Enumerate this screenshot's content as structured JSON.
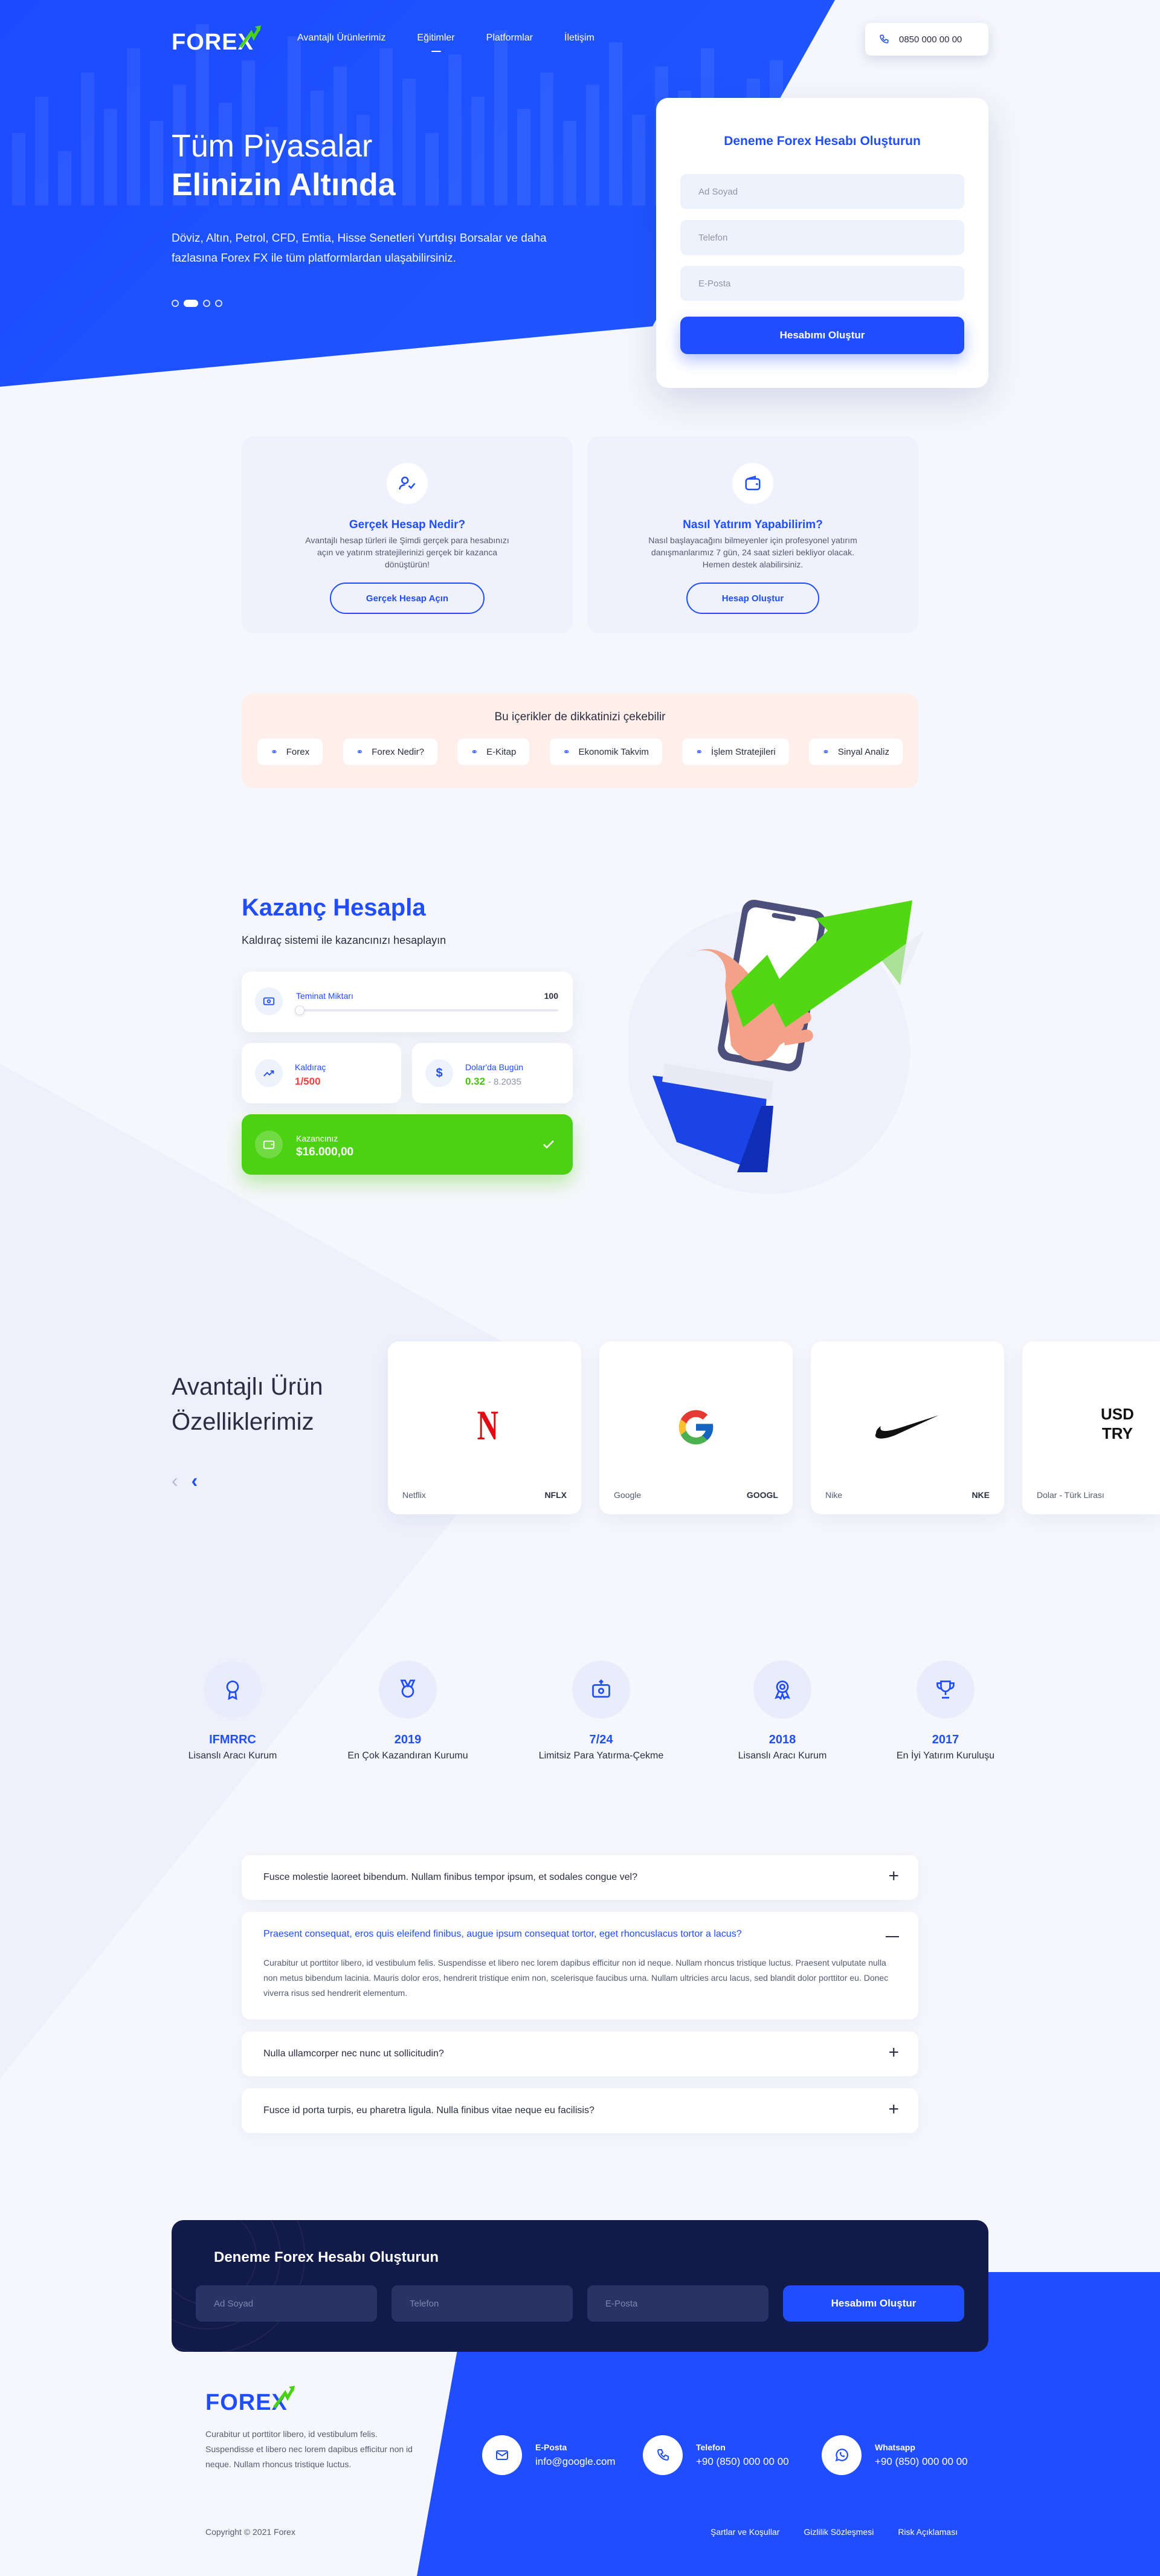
{
  "brand": {
    "logo_text": "FOREX",
    "logo_accent": "#47d40f",
    "primary": "#1f4dff",
    "dark": "#121a4a"
  },
  "nav": {
    "items": [
      {
        "label": "Avantajlı Ürünlerimiz"
      },
      {
        "label": "Eğitimler"
      },
      {
        "label": "Platformlar"
      },
      {
        "label": "İletişim"
      }
    ],
    "phone": "0850 000 00 00"
  },
  "hero": {
    "title_light": "Tüm Piyasalar",
    "title_bold": "Elinizin Altında",
    "description": "Döviz, Altın, Petrol, CFD, Emtia, Hisse Senetleri Yurtdışı Borsalar ve daha fazlasına Forex FX ile tüm platformlardan ulaşabilirsiniz.",
    "slider": {
      "current": 2,
      "total": 4
    }
  },
  "signup": {
    "title": "Deneme Forex Hesabı Oluşturun",
    "name_placeholder": "Ad Soyad",
    "phone_placeholder": "Telefon",
    "email_placeholder": "E-Posta",
    "button": "Hesabımı Oluştur"
  },
  "info_cards": [
    {
      "title": "Gerçek Hesap Nedir?",
      "text": "Avantajlı hesap türleri ile Şimdi gerçek para hesabınızı açın ve yatırım stratejilerinizi gerçek bir kazanca dönüştürün!",
      "button": "Gerçek Hesap Açın",
      "icon": "user-check-icon"
    },
    {
      "title": "Nasıl Yatırım Yapabilirim?",
      "text": "Nasıl başlayacağını bilmeyenler için profesyonel yatırım danışmanlarımız 7 gün, 24 saat sizleri bekliyor olacak. Hemen destek alabilirsiniz.",
      "button": "Hesap Oluştur",
      "icon": "wallet-icon"
    }
  ],
  "topics": {
    "title": "Bu içerikler de dikkatinizi çekebilir",
    "items": [
      "Forex",
      "Forex Nedir?",
      "E-Kitap",
      "Ekonomik Takvim",
      "İşlem Stratejileri",
      "Sinyal Analiz"
    ]
  },
  "calculator": {
    "title": "Kazanç Hesapla",
    "subtitle": "Kaldıraç sistemi ile kazancınızı hesaplayın",
    "margin_label": "Teminat Miktarı",
    "margin_value": "100",
    "leverage_label": "Kaldıraç",
    "leverage_value": "1/500",
    "usd_label": "Dolar'da Bugün",
    "usd_value": "0.32",
    "usd_rate": "- 8.2035",
    "earn_label": "Kazancınız",
    "earn_value": "$16.000,00"
  },
  "products": {
    "title_line1": "Avantajlı Ürün",
    "title_line2": "Özelliklerimiz",
    "items": [
      {
        "name": "Netflix",
        "code": "NFLX",
        "icon": "netflix-logo-icon"
      },
      {
        "name": "Google",
        "code": "GOOGL",
        "icon": "google-logo-icon"
      },
      {
        "name": "Nike",
        "code": "NKE",
        "icon": "nike-logo-icon"
      },
      {
        "name": "Dolar - Türk Lirası",
        "code": "",
        "badge_line1": "USD",
        "badge_line2": "TRY"
      }
    ]
  },
  "stats": [
    {
      "value": "IFMRRC",
      "label": "Lisanslı Aracı Kurum",
      "icon": "medal-icon"
    },
    {
      "value": "2019",
      "label": "En Çok Kazandıran Kurumu",
      "icon": "award-icon"
    },
    {
      "value": "7/24",
      "label": "Limitsiz Para Yatırma-Çekme",
      "icon": "cash-icon"
    },
    {
      "value": "2018",
      "label": "Lisanslı Aracı Kurum",
      "icon": "rosette-icon"
    },
    {
      "value": "2017",
      "label": "En İyi Yatırım Kuruluşu",
      "icon": "trophy-icon"
    }
  ],
  "faq": [
    {
      "q": "Fusce molestie laoreet bibendum. Nullam finibus tempor ipsum, et sodales congue vel?",
      "open": false
    },
    {
      "q": "Praesent consequat, eros quis eleifend finibus, augue ipsum consequat tortor, eget rhoncuslacus tortor a lacus?",
      "open": true,
      "a": "Curabitur ut porttitor libero, id vestibulum felis. Suspendisse et libero nec lorem dapibus efficitur non id neque. Nullam rhoncus tristique luctus. Praesent vulputate nulla non metus bibendum lacinia. Mauris dolor eros, hendrerit tristique enim non, scelerisque faucibus urna. Nullam ultricies arcu lacus, sed blandit dolor porttitor eu. Donec viverra risus sed hendrerit elementum."
    },
    {
      "q": "Nulla ullamcorper nec nunc ut sollicitudin?",
      "open": false
    },
    {
      "q": "Fusce id porta turpis, eu pharetra ligula. Nulla finibus vitae neque eu facilisis?",
      "open": false
    }
  ],
  "footer_signup": {
    "title": "Deneme Forex Hesabı Oluşturun",
    "name_placeholder": "Ad Soyad",
    "phone_placeholder": "Telefon",
    "email_placeholder": "E-Posta",
    "button": "Hesabımı Oluştur"
  },
  "footer": {
    "about": "Curabitur ut porttitor libero, id vestibulum felis. Suspendisse et libero nec lorem dapibus efficitur non id neque. Nullam rhoncus tristique luctus.",
    "contacts": [
      {
        "label": "E-Posta",
        "value": "info@google.com",
        "icon": "mail-icon"
      },
      {
        "label": "Telefon",
        "value": "+90 (850) 000 00 00",
        "icon": "phone-icon"
      },
      {
        "label": "Whatsapp",
        "value": "+90 (850) 000 00 00",
        "icon": "whatsapp-icon"
      }
    ],
    "copyright": "Copyright © 2021 Forex",
    "links": [
      "Şartlar ve Koşullar",
      "Gizlilik Sözleşmesi",
      "Risk Açıklaması"
    ]
  }
}
